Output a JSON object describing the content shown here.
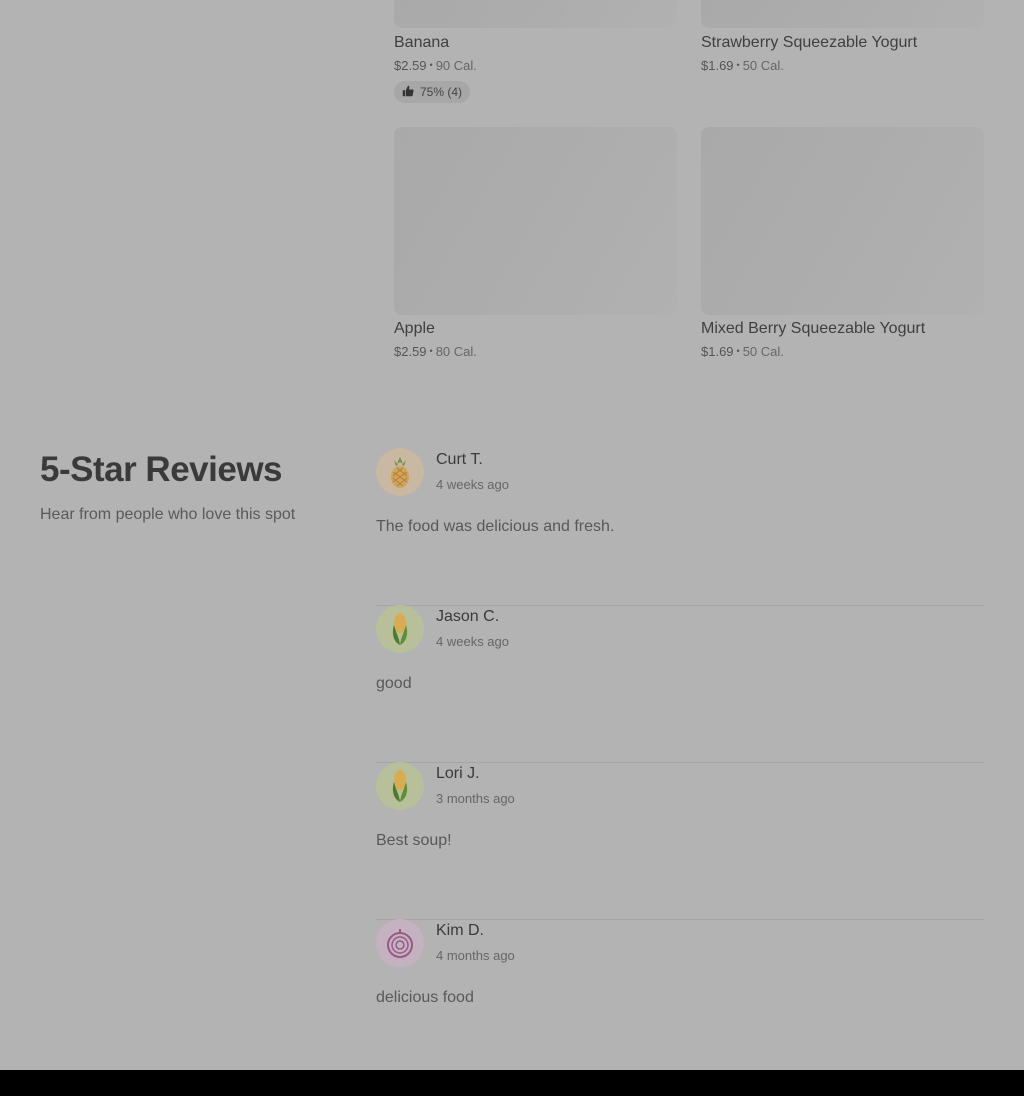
{
  "menu": {
    "items": [
      {
        "name": "Banana",
        "price": "$2.59",
        "calories": "90 Cal.",
        "rating": "75% (4)",
        "icon": "thumbs-up-icon"
      },
      {
        "name": "Strawberry Squeezable Yogurt",
        "price": "$1.69",
        "calories": "50 Cal."
      },
      {
        "name": "Apple",
        "price": "$2.59",
        "calories": "80 Cal."
      },
      {
        "name": "Mixed Berry Squeezable Yogurt",
        "price": "$1.69",
        "calories": "50 Cal."
      }
    ],
    "separator": "•"
  },
  "reviews": {
    "title": "5-Star Reviews",
    "subtitle": "Hear from people who love this spot",
    "items": [
      {
        "author": "Curt T.",
        "time": "4 weeks ago",
        "text": "The food was delicious and fresh.",
        "avatar_icon": "pineapple-icon",
        "avatar_color": "#c9b8a2"
      },
      {
        "author": "Jason C.",
        "time": "4 weeks ago",
        "text": "good",
        "avatar_icon": "corn-icon",
        "avatar_color": "#b7c09a"
      },
      {
        "author": "Lori J.",
        "time": "3 months ago",
        "text": "Best soup!",
        "avatar_icon": "corn-icon",
        "avatar_color": "#b7c09a"
      },
      {
        "author": "Kim D.",
        "time": "4 months ago",
        "text": "delicious food",
        "avatar_icon": "onion-icon",
        "avatar_color": "#c4b2c0"
      }
    ]
  }
}
